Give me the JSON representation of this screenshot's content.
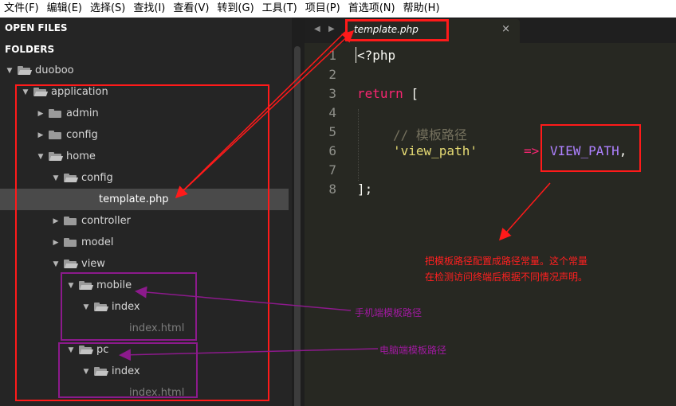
{
  "menu": [
    "文件(F)",
    "编辑(E)",
    "选择(S)",
    "查找(I)",
    "查看(V)",
    "转到(G)",
    "工具(T)",
    "项目(P)",
    "首选项(N)",
    "帮助(H)"
  ],
  "sidebar": {
    "open_files_header": "OPEN FILES",
    "folders_header": "FOLDERS",
    "tree": [
      {
        "label": "duoboo",
        "expanded": true,
        "kind": "folder"
      },
      {
        "label": "application",
        "expanded": true,
        "kind": "folder"
      },
      {
        "label": "admin",
        "expanded": false,
        "kind": "folder"
      },
      {
        "label": "config",
        "expanded": false,
        "kind": "folder"
      },
      {
        "label": "home",
        "expanded": true,
        "kind": "folder"
      },
      {
        "label": "config",
        "expanded": true,
        "kind": "folder"
      },
      {
        "label": "template.php",
        "kind": "file",
        "selected": true
      },
      {
        "label": "controller",
        "expanded": false,
        "kind": "folder"
      },
      {
        "label": "model",
        "expanded": false,
        "kind": "folder"
      },
      {
        "label": "view",
        "expanded": true,
        "kind": "folder"
      },
      {
        "label": "mobile",
        "expanded": true,
        "kind": "folder"
      },
      {
        "label": "index",
        "expanded": true,
        "kind": "folder"
      },
      {
        "label": "index.html",
        "kind": "file"
      },
      {
        "label": "pc",
        "expanded": true,
        "kind": "folder"
      },
      {
        "label": "index",
        "expanded": true,
        "kind": "folder"
      },
      {
        "label": "index.html",
        "kind": "file"
      }
    ]
  },
  "editor": {
    "tab_title": "template.php",
    "close_glyph": "×",
    "nav_left": "◀",
    "nav_right": "▶",
    "line_numbers": [
      "1",
      "2",
      "3",
      "4",
      "5",
      "6",
      "7",
      "8"
    ],
    "code": {
      "line1": "<?php",
      "line3_kw": "return",
      "line3_rest": " [",
      "line5_comment": "// 模板路径",
      "line6_str": "'view_path'",
      "line6_arrow": "=>",
      "line6_const": "VIEW_PATH",
      "line6_end": ",",
      "line8": "];"
    }
  },
  "annotations": {
    "note_main_1": "把模板路径配置成路径常量。这个常量",
    "note_main_2": "在检测访问终端后根据不同情况声明。",
    "note_mobile": "手机端模板路径",
    "note_pc": "电脑端模板路径"
  },
  "colors": {
    "menubar_bg": "#ffffff",
    "sidebar_bg": "#252525",
    "editor_bg": "#272822",
    "keyword": "#f92672",
    "string": "#e6db74",
    "constant": "#ae81ff",
    "comment": "#75715e",
    "annotation_red": "#ff1a1a",
    "annotation_purple": "#8c1a8c"
  }
}
